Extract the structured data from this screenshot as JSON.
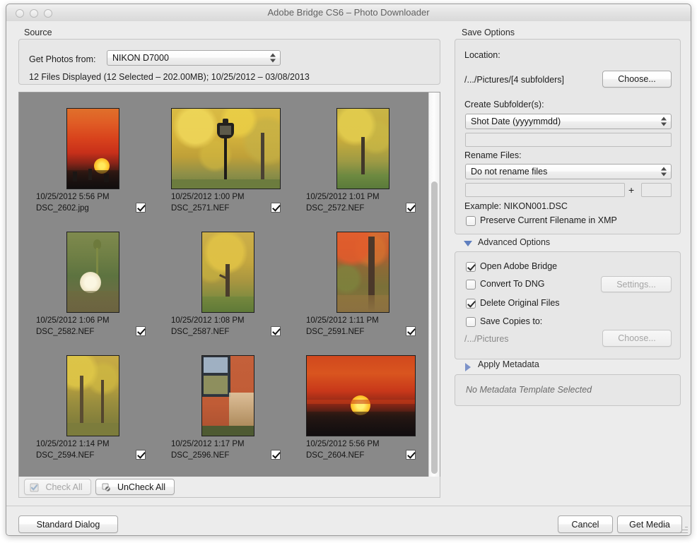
{
  "window": {
    "title": "Adobe Bridge CS6 – Photo Downloader",
    "traffic": {
      "close": "close-button",
      "minimize": "minimize-button",
      "zoom": "zoom-button"
    }
  },
  "source": {
    "group_label": "Source",
    "get_photos_label": "Get Photos from:",
    "device_value": "NIKON D7000",
    "status_text": "12 Files Displayed (12 Selected – 202.00MB); 10/25/2012 – 03/08/2013",
    "check_all_label": "Check All",
    "uncheck_all_label": "UnCheck All"
  },
  "thumbnails": [
    {
      "date": "10/25/2012 5:56 PM",
      "filename": "DSC_2602.jpg",
      "checked": true,
      "kind": "sunset-city"
    },
    {
      "date": "10/25/2012 1:00 PM",
      "filename": "DSC_2571.NEF",
      "checked": true,
      "kind": "lamppost-autumn"
    },
    {
      "date": "10/25/2012 1:01 PM",
      "filename": "DSC_2572.NEF",
      "checked": true,
      "kind": "yellow-tree-park"
    },
    {
      "date": "10/25/2012 1:06 PM",
      "filename": "DSC_2582.NEF",
      "checked": true,
      "kind": "dandelion"
    },
    {
      "date": "10/25/2012 1:08 PM",
      "filename": "DSC_2587.NEF",
      "checked": true,
      "kind": "golden-tree"
    },
    {
      "date": "10/25/2012 1:11 PM",
      "filename": "DSC_2591.NEF",
      "checked": true,
      "kind": "red-maple"
    },
    {
      "date": "10/25/2012 1:14 PM",
      "filename": "DSC_2594.NEF",
      "checked": true,
      "kind": "yellow-path"
    },
    {
      "date": "10/25/2012 1:17 PM",
      "filename": "DSC_2596.NEF",
      "checked": true,
      "kind": "orange-wall-window"
    },
    {
      "date": "10/25/2012 5:56 PM",
      "filename": "DSC_2604.NEF",
      "checked": true,
      "kind": "sunset-wide"
    }
  ],
  "save_options": {
    "group_label": "Save Options",
    "location_label": "Location:",
    "location_path": "/.../Pictures/[4 subfolders]",
    "location_choose_label": "Choose...",
    "create_subfolder_label": "Create Subfolder(s):",
    "create_subfolder_value": "Shot Date (yyyymmdd)",
    "create_subfolder_custom_value": "",
    "rename_files_label": "Rename Files:",
    "rename_files_value": "Do not rename files",
    "rename_custom_value": "",
    "rename_plus": "+",
    "rename_number_value": "",
    "example_label": "Example:  NIKON001.DSC",
    "preserve_xmp_label": "Preserve Current Filename in XMP",
    "preserve_xmp_checked": false
  },
  "advanced_options": {
    "header": "Advanced Options",
    "expanded": true,
    "open_bridge_label": "Open Adobe Bridge",
    "open_bridge_checked": true,
    "convert_dng_label": "Convert To DNG",
    "convert_dng_checked": false,
    "settings_label": "Settings...",
    "delete_originals_label": "Delete Original Files",
    "delete_originals_checked": true,
    "save_copies_label": "Save Copies to:",
    "save_copies_checked": false,
    "save_copies_path": "/.../Pictures",
    "save_copies_choose_label": "Choose..."
  },
  "apply_metadata": {
    "header": "Apply Metadata",
    "expanded": false,
    "empty_text": "No Metadata Template Selected"
  },
  "footer": {
    "standard_dialog_label": "Standard Dialog",
    "cancel_label": "Cancel",
    "get_media_label": "Get Media"
  },
  "colors": {
    "dialog_bg": "#ececec",
    "panel_bg": "#e7e7e7",
    "thumb_panel_bg": "#898989",
    "disclosure_blue": "#5f7fbf"
  }
}
